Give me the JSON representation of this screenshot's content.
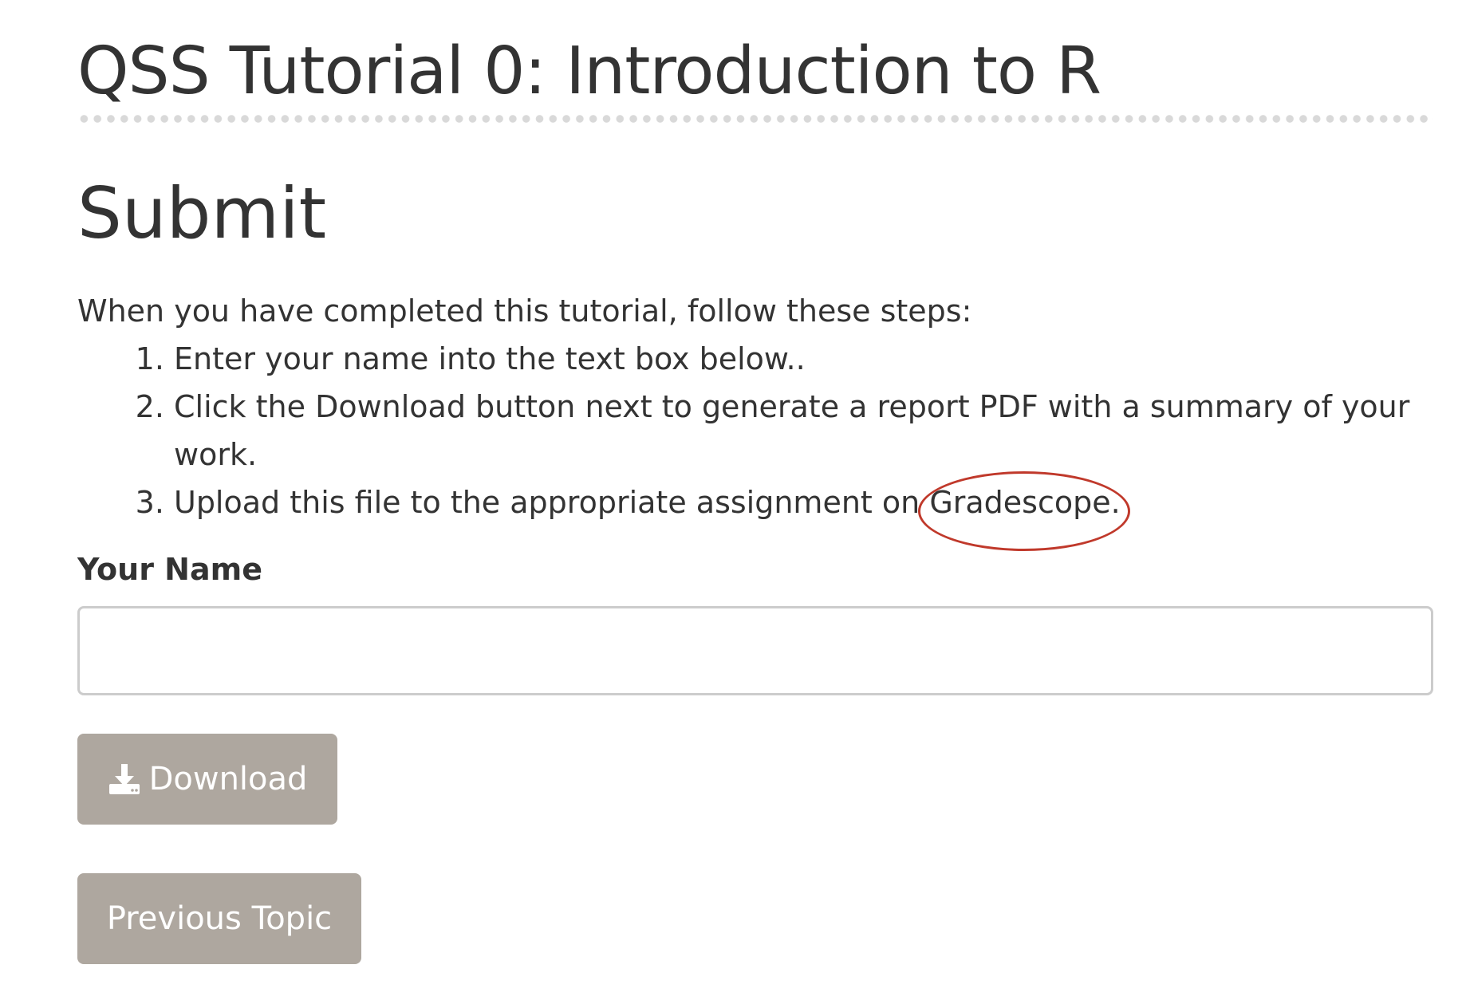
{
  "header": {
    "title": "QSS Tutorial 0: Introduction to R"
  },
  "section": {
    "title": "Submit",
    "intro": "When you have completed this tutorial, follow these steps:",
    "steps": [
      "Enter your name into the text box below..",
      "Click the Download button next to generate a report PDF with a summary of your work.",
      "Upload this file to the appropriate assignment on",
      "Gradescope."
    ]
  },
  "form": {
    "name_label": "Your Name",
    "name_value": "",
    "download_label": "Download",
    "download_icon": "download-icon"
  },
  "nav": {
    "previous_label": "Previous Topic"
  },
  "colors": {
    "button_bg": "#aea79f",
    "annotation": "#c0392b",
    "text": "#333333"
  }
}
